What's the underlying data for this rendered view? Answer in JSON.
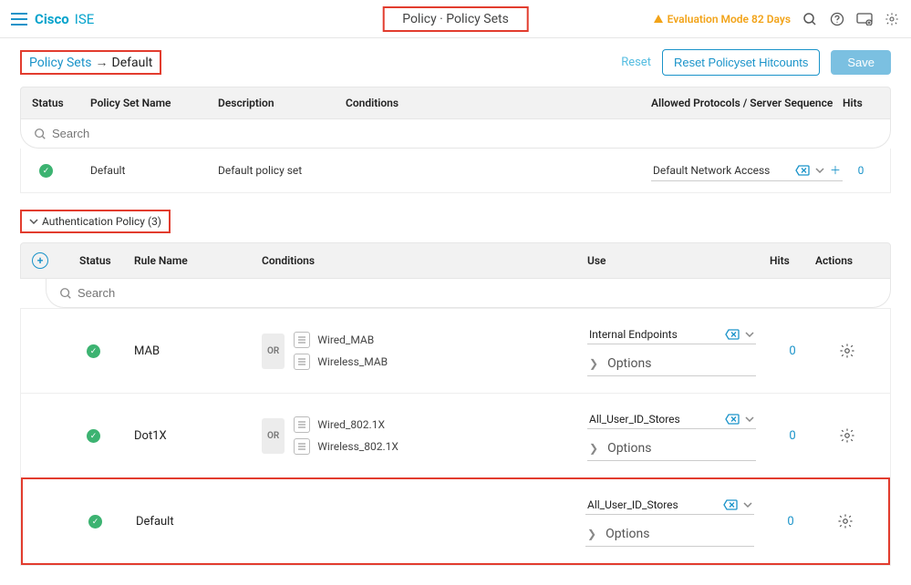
{
  "brand": {
    "name": "Cisco",
    "suffix": "ISE"
  },
  "page_title": "Policy · Policy Sets",
  "eval": {
    "label": "Evaluation Mode 82 Days"
  },
  "breadcrumb": {
    "root": "Policy Sets",
    "current": "Default"
  },
  "actions": {
    "reset": "Reset",
    "reset_hitcounts": "Reset Policyset Hitcounts",
    "save": "Save"
  },
  "policyset_header": {
    "status": "Status",
    "name": "Policy Set Name",
    "description": "Description",
    "conditions": "Conditions",
    "allowed": "Allowed Protocols / Server Sequence",
    "hits": "Hits"
  },
  "search_placeholder": "Search",
  "policyset_row": {
    "name": "Default",
    "description": "Default policy set",
    "allowed": "Default Network Access",
    "hits": "0"
  },
  "auth_section": {
    "title": "Authentication Policy (3)"
  },
  "auth_header": {
    "status": "Status",
    "rule": "Rule Name",
    "conditions": "Conditions",
    "use": "Use",
    "hits": "Hits",
    "actions": "Actions"
  },
  "options_label": "Options",
  "rules": [
    {
      "name": "MAB",
      "op": "OR",
      "conditions": [
        "Wired_MAB",
        "Wireless_MAB"
      ],
      "use": "Internal Endpoints",
      "hits": "0"
    },
    {
      "name": "Dot1X",
      "op": "OR",
      "conditions": [
        "Wired_802.1X",
        "Wireless_802.1X"
      ],
      "use": "All_User_ID_Stores",
      "hits": "0"
    },
    {
      "name": "Default",
      "op": "",
      "conditions": [],
      "use": "All_User_ID_Stores",
      "hits": "0"
    }
  ]
}
